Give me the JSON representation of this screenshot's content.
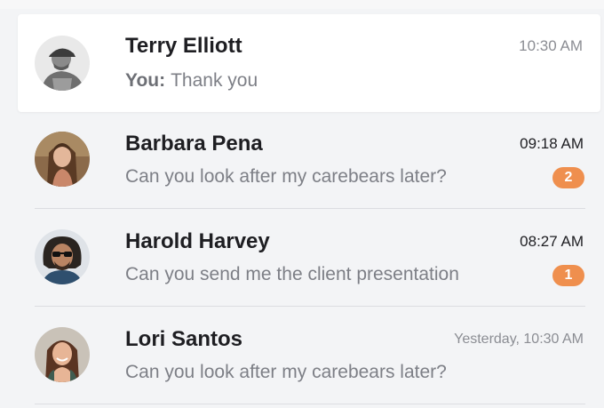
{
  "conversations": [
    {
      "name": "Terry Elliott",
      "sender_prefix": "You:",
      "message": "Thank you",
      "time": "10:30 AM",
      "unread": null,
      "avatar": "grayscale-man-with-cap"
    },
    {
      "name": "Barbara Pena",
      "message": "Can you look after my carebears later?",
      "time": "09:18 AM",
      "unread": "2",
      "avatar": "woman-with-long-hair"
    },
    {
      "name": "Harold Harvey",
      "message": "Can you send me the client presentation",
      "time": "08:27 AM",
      "unread": "1",
      "avatar": "man-with-sunglasses"
    },
    {
      "name": "Lori Santos",
      "message": "Can you look after my carebears later?",
      "time": "Yesterday, 10:30 AM",
      "unread": null,
      "avatar": "smiling-woman"
    }
  ],
  "colors": {
    "badge": "#ef8f4e",
    "active_row": "#ffffff",
    "list_background": "#f3f4f6"
  }
}
